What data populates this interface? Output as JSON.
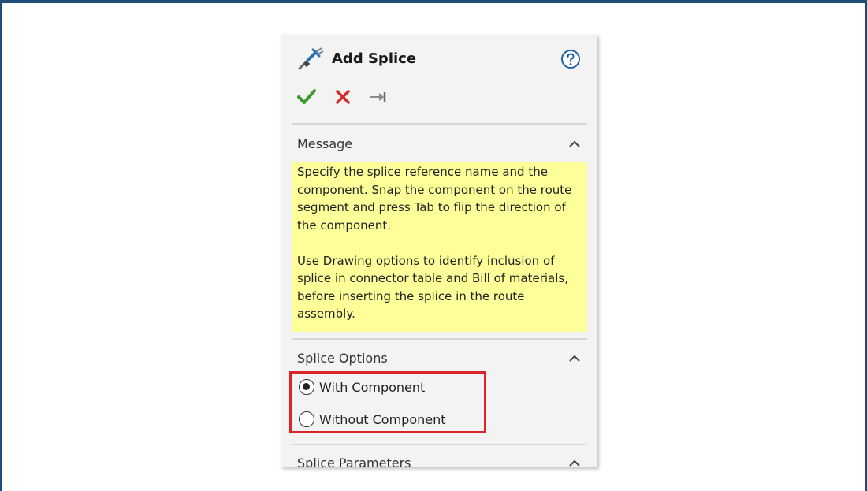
{
  "panel": {
    "title": "Add Splice",
    "icons": {
      "app": "splice-icon",
      "help": "help-icon",
      "ok": "checkmark-icon",
      "cancel": "close-icon",
      "pin": "pushpin-icon"
    },
    "colors": {
      "ok": "#3a9b2c",
      "cancel": "#d9262a",
      "message_background": "#ffff99",
      "highlight_border": "#d9262a",
      "frame_border": "#1f4e79"
    }
  },
  "message": {
    "header": "Message",
    "paragraph1": "Specify the splice reference name and the component. Snap the component on the route segment and press Tab to flip the direction of the component.",
    "paragraph2": "Use Drawing options to identify inclusion of splice in connector table and Bill of materials, before inserting the splice in the route assembly."
  },
  "splice_options": {
    "header": "Splice Options",
    "options": [
      {
        "label": "With Component",
        "selected": true
      },
      {
        "label": "Without Component",
        "selected": false
      }
    ]
  },
  "splice_parameters": {
    "header": "Splice Parameters"
  }
}
